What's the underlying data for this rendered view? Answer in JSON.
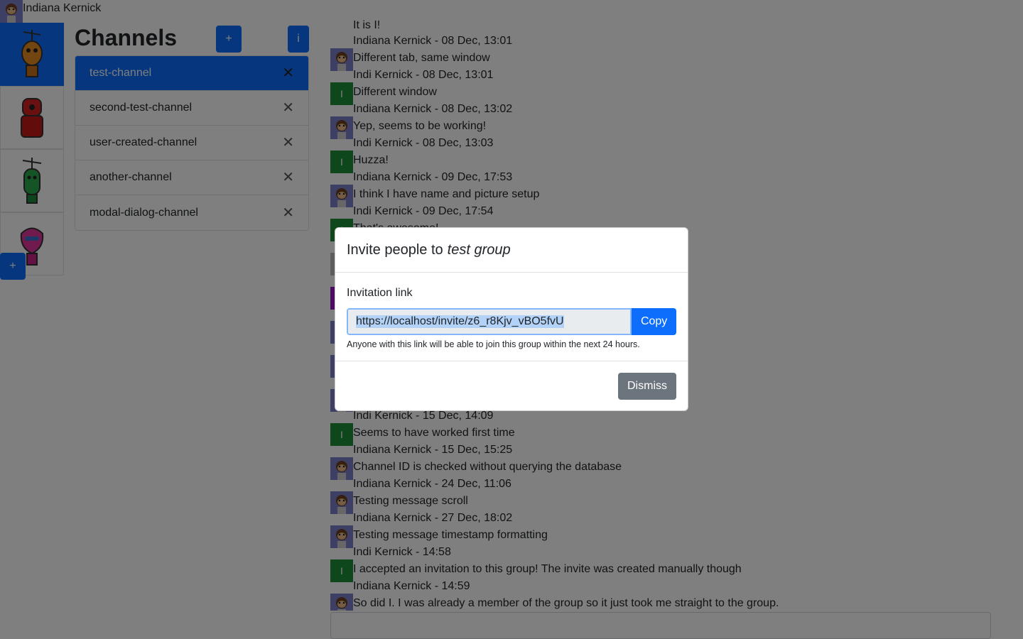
{
  "user": {
    "name": "Indiana Kernick"
  },
  "groups": {
    "items": [
      {
        "icon": "orange-robot-icon",
        "active": true
      },
      {
        "icon": "red-robot-icon",
        "active": false
      },
      {
        "icon": "green-robot-icon",
        "active": false
      },
      {
        "icon": "pink-robot-icon",
        "active": false
      }
    ],
    "add_label": "+"
  },
  "channels": {
    "title": "Channels",
    "add_label": "+",
    "info_label": "i",
    "items": [
      {
        "label": "test-channel",
        "active": true
      },
      {
        "label": "second-test-channel",
        "active": false
      },
      {
        "label": "user-created-channel",
        "active": false
      },
      {
        "label": "another-channel",
        "active": false
      },
      {
        "label": "modal-dialog-channel",
        "active": false
      }
    ],
    "close_glyph": "✕"
  },
  "messages": [
    {
      "header": "",
      "text": "It is I!"
    },
    {
      "header": "Indiana Kernick - 08 Dec, 13:01",
      "text": "Different tab, same window",
      "avatar": "monkey"
    },
    {
      "header": "Indi Kernick - 08 Dec, 13:01",
      "text": "Different window",
      "avatar": "I"
    },
    {
      "header": "Indiana Kernick - 08 Dec, 13:02",
      "text": "Yep, seems to be working!",
      "avatar": "monkey"
    },
    {
      "header": "Indi Kernick - 08 Dec, 13:03",
      "text": "Huzza!",
      "avatar": "I"
    },
    {
      "header": "Indiana Kernick - 09 Dec, 17:53",
      "text": "I think I have name and picture setup",
      "avatar": "monkey"
    },
    {
      "header": "Indi Kernick - 09 Dec, 17:54",
      "text": "That's awesome!",
      "avatar": "I"
    },
    {
      "header": "",
      "text": "",
      "avatar": "grey"
    },
    {
      "header": "",
      "text": "",
      "avatar": "purple"
    },
    {
      "header": "",
      "text": "",
      "avatar": "monkey"
    },
    {
      "header": "",
      "text": "",
      "avatar": "monkey"
    },
    {
      "header": "",
      "text": "",
      "avatar": "monkey"
    },
    {
      "header": "Indi Kernick - 15 Dec, 14:09",
      "text": "Seems to have worked first time",
      "avatar": "I"
    },
    {
      "header": "Indiana Kernick - 15 Dec, 15:25",
      "text": "Channel ID is checked without querying the database",
      "avatar": "monkey"
    },
    {
      "header": "Indiana Kernick - 24 Dec, 11:06",
      "text": "Testing message scroll",
      "avatar": "monkey"
    },
    {
      "header": "Indiana Kernick - 27 Dec, 18:02",
      "text": "Testing message timestamp formatting",
      "avatar": "monkey"
    },
    {
      "header": "Indi Kernick - 14:58",
      "text": "I accepted an invitation to this group! The invite was created manually though",
      "avatar": "I"
    },
    {
      "header": "Indiana Kernick - 14:59",
      "text": "So did I. I was already a member of the group so it just took me straight to the group.",
      "avatar": "monkey"
    }
  ],
  "modal": {
    "title_prefix": "Invite people to",
    "group_name": "test group",
    "label": "Invitation link",
    "link": "https://localhost/invite/z6_r8Kjv_vBO5fvU",
    "copy_label": "Copy",
    "hint": "Anyone with this link will be able to join this group within the next 24 hours.",
    "dismiss_label": "Dismiss"
  }
}
